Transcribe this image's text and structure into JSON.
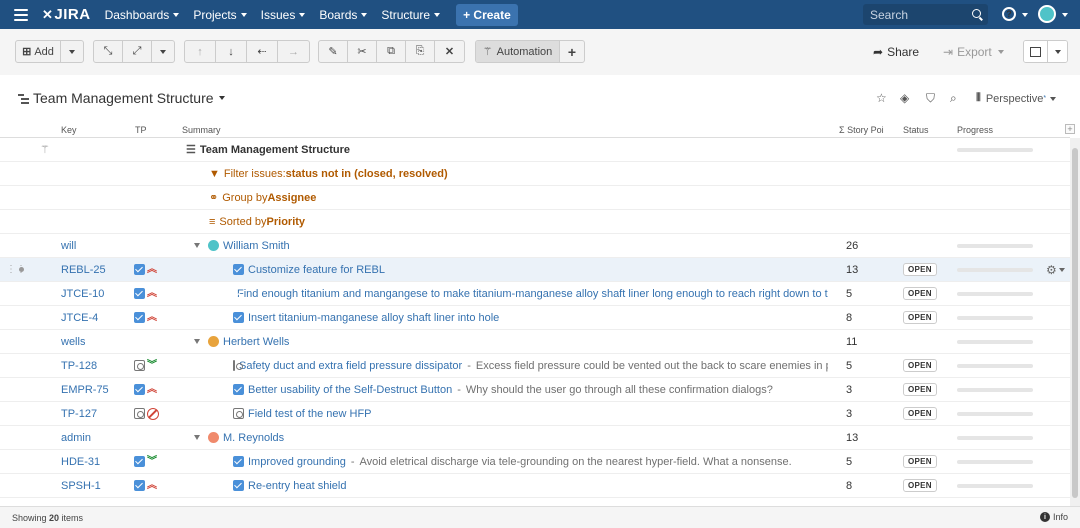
{
  "topnav": {
    "logo": "JIRA",
    "items": [
      "Dashboards",
      "Projects",
      "Issues",
      "Boards",
      "Structure"
    ],
    "create_label": "+ Create",
    "search_placeholder": "Search",
    "help": "?"
  },
  "toolbar": {
    "add_label": "Add",
    "automation_label": "Automation",
    "share_label": "Share",
    "export_label": "Export"
  },
  "structure": {
    "title": "Team Management Structure",
    "perspective_label": "Perspective"
  },
  "columns": {
    "key": "Key",
    "tp": "TP",
    "summary": "Summary",
    "story_points": "Σ Story Poi",
    "status": "Status",
    "progress": "Progress"
  },
  "rows": [
    {
      "type": "root",
      "summary": "Team Management Structure"
    },
    {
      "type": "filter",
      "prefix": "Filter issues: ",
      "bold": "status not in (closed, resolved)"
    },
    {
      "type": "group",
      "prefix": "Group by ",
      "bold": "Assignee"
    },
    {
      "type": "sort",
      "prefix": "Sorted by ",
      "bold": "Priority"
    },
    {
      "type": "user",
      "key": "will",
      "name": "William Smith",
      "sp": "26",
      "avatar_color": "#4fc3c8"
    },
    {
      "type": "issue",
      "key": "REBL-25",
      "issuetype": "task",
      "priority": "up",
      "title": "Customize feature for REBL",
      "desc": "",
      "sp": "13",
      "status": "OPEN",
      "selected": true
    },
    {
      "type": "issue",
      "key": "JTCE-10",
      "issuetype": "task",
      "priority": "up",
      "title": "Find enough titanium and mangangese to make titanium-manganese alloy shaft liner long enough to reach right down to the Ear",
      "desc": "",
      "sp": "5",
      "status": "OPEN"
    },
    {
      "type": "issue",
      "key": "JTCE-4",
      "issuetype": "task",
      "priority": "up",
      "title": "Insert titanium-manganese alloy shaft liner into hole",
      "desc": "",
      "sp": "8",
      "status": "OPEN"
    },
    {
      "type": "user",
      "key": "wells",
      "name": "Herbert Wells",
      "sp": "11",
      "avatar_color": "#e8a33c"
    },
    {
      "type": "issue",
      "key": "TP-128",
      "issuetype": "subtask",
      "priority": "down",
      "title": "Safety duct and extra field pressure dissipator",
      "desc": "Excess field pressure could be vented out the back to scare enemies in pursuit",
      "sp": "5",
      "status": "OPEN"
    },
    {
      "type": "issue",
      "key": "EMPR-75",
      "issuetype": "task",
      "priority": "up",
      "title": "Better usability of the Self-Destruct Button",
      "desc": "Why should the user go through all these confirmation dialogs?",
      "sp": "3",
      "status": "OPEN"
    },
    {
      "type": "issue",
      "key": "TP-127",
      "issuetype": "subtask",
      "priority": "blocked",
      "title": "Field test of the new HFP",
      "desc": "",
      "sp": "3",
      "status": "OPEN"
    },
    {
      "type": "user",
      "key": "admin",
      "name": "M. Reynolds",
      "sp": "13",
      "avatar_color": "#f08a6c"
    },
    {
      "type": "issue",
      "key": "HDE-31",
      "issuetype": "task",
      "priority": "down",
      "title": "Improved grounding",
      "desc": "Avoid eletrical discharge via tele-grounding on the nearest hyper-field. What a nonsense.",
      "sp": "5",
      "status": "OPEN"
    },
    {
      "type": "issue",
      "key": "SPSH-1",
      "issuetype": "task",
      "priority": "up",
      "title": "Re-entry heat shield",
      "desc": "",
      "sp": "8",
      "status": "OPEN"
    }
  ],
  "footer": {
    "showing_prefix": "Showing ",
    "count": "20",
    "showing_suffix": " items",
    "info_label": "Info"
  },
  "colors": {
    "nav_bg": "#205081",
    "link": "#3572b0",
    "priority_high": "#d04437",
    "priority_low": "#14892c",
    "config_orange": "#b05a00"
  }
}
